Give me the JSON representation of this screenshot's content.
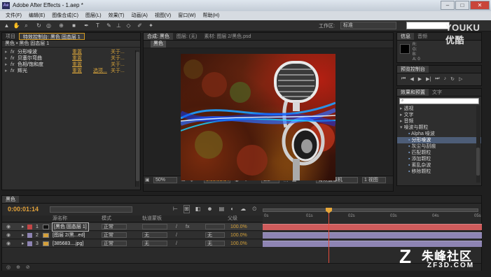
{
  "window": {
    "title": "Adobe After Effects - 1.aep *"
  },
  "menu": [
    "文件(F)",
    "编辑(E)",
    "图像合成(C)",
    "图层(L)",
    "效果(T)",
    "动画(A)",
    "视图(V)",
    "窗口(W)",
    "帮助(H)"
  ],
  "toolbar": {
    "workspace_label": "工作区:",
    "workspace_value": "标准",
    "search_placeholder": ""
  },
  "left_panel": {
    "tabs": [
      "项目",
      "特效控制台: 黑色 固态层 1"
    ],
    "header": "黑色 • 黑色 固态层 1",
    "effects": [
      {
        "name": "分形噪波",
        "reset": "重置",
        "extra": "",
        "about": "关于..."
      },
      {
        "name": "贝塞尔弯曲",
        "reset": "重置",
        "extra": "",
        "about": "关于..."
      },
      {
        "name": "色相/饱和度",
        "reset": "重置",
        "extra": "",
        "about": "关于..."
      },
      {
        "name": "辉光",
        "reset": "重置",
        "extra": "选项...",
        "about": "关于..."
      }
    ]
  },
  "viewer": {
    "tabs": [
      "合成: 黑色",
      "图层: (无)",
      "素材: 图层 2/黑色.psd"
    ],
    "comp_tab": "黑色",
    "zoom": "50%",
    "timecode": "0:00:01:14",
    "quality": "1/2",
    "camera": "有效摄像机",
    "view": "1 视图"
  },
  "right_panel": {
    "info_tabs": [
      "信息",
      "音频"
    ],
    "info_rgb": [
      "R:",
      "G:",
      "B:",
      "A: 0"
    ],
    "preview_tab": "预览控制台",
    "effects_tabs": [
      "效果和预置",
      "文字"
    ],
    "categories": [
      "透视",
      "文字",
      "音频",
      "噪波与颗粒"
    ],
    "items": [
      "Alpha 噪波",
      "分形噪波",
      "灰尘与刮痕",
      "匹配颗粒",
      "添加颗粒",
      "紊乱杂波",
      "移除颗粒"
    ],
    "selected_index": 1
  },
  "timeline": {
    "tab": "黑色",
    "timecode": "0:00:01:14",
    "col_source": "源名称",
    "col_mode": "模式",
    "col_trkmat": "轨道蒙板",
    "col_parent": "父级",
    "ruler_ticks": [
      "0s",
      "01s",
      "02s",
      "03s",
      "04s",
      "05s"
    ],
    "layers": [
      {
        "num": "1",
        "name": "[黑色 固态层 1]",
        "mode": "正常",
        "trkmat": "",
        "parent": "",
        "stretch": "100.0%",
        "color": "#cf5b5b",
        "label": "#c24646"
      },
      {
        "num": "2",
        "name": "[图层 2/黑...ed]",
        "mode": "正常",
        "trkmat": "无",
        "parent": "无",
        "stretch": "100.0%",
        "color": "#8e84b3",
        "label": "#8e84b3"
      },
      {
        "num": "3",
        "name": "[385683....jpg]",
        "mode": "正常",
        "trkmat": "无",
        "parent": "无",
        "stretch": "100.0%",
        "color": "#8e84b3",
        "label": "#8e84b3"
      }
    ]
  },
  "watermarks": {
    "top": "YOUKU 优酷",
    "bottom_cn": "朱峰社区",
    "bottom_en": "ZF3D.COM"
  }
}
